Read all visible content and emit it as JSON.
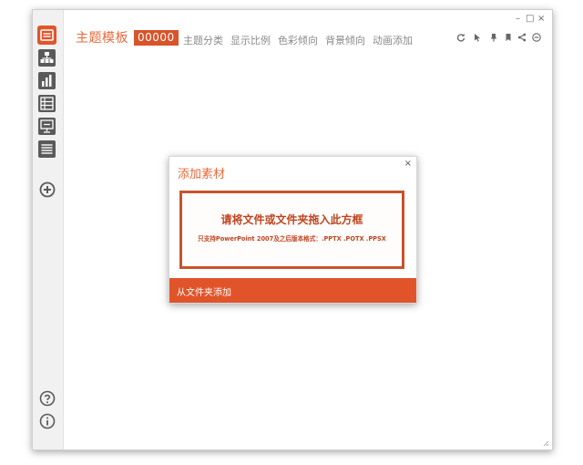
{
  "app": {
    "title": "主题模板",
    "badge": "00000",
    "accent_color": "#e1542a"
  },
  "nav": [
    {
      "label": "主题分类"
    },
    {
      "label": "显示比例"
    },
    {
      "label": "色彩倾向"
    },
    {
      "label": "背景倾向"
    },
    {
      "label": "动画添加"
    }
  ],
  "window_controls": {
    "minimize": "–",
    "maximize": "□",
    "close": "×"
  },
  "toolbar_icons": [
    "refresh-icon",
    "pointer-icon",
    "pin-icon",
    "bookmark-icon",
    "share-icon",
    "minus-circle-icon"
  ],
  "sidebar_icons": [
    "template-icon",
    "org-chart-icon",
    "bar-chart-icon",
    "table-icon",
    "presentation-icon",
    "list-icon",
    "add-icon",
    "help-icon",
    "info-icon"
  ],
  "dialog": {
    "title": "添加素材",
    "close": "×",
    "drop_main": "请将文件或文件夹拖入此方框",
    "drop_sub": "只支持PowerPoint 2007及之后版本格式：.PPTX .POTX .PPSX",
    "footer_label": "从文件夹添加"
  }
}
